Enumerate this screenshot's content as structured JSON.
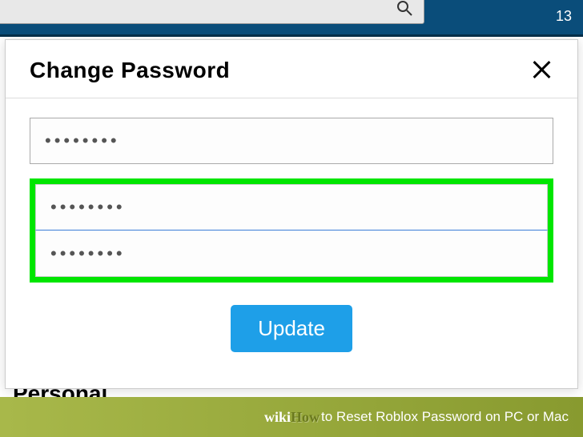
{
  "topbar": {
    "time_fragment": "13"
  },
  "modal": {
    "title": "Change Password",
    "current_password": "••••••••",
    "new_password": "••••••••",
    "confirm_password": "••••••••",
    "update_label": "Update"
  },
  "page": {
    "heading_fragment": "Personal"
  },
  "caption": {
    "brand_prefix": "wiki",
    "brand_suffix": "How",
    "text": " to Reset Roblox Password on PC or Mac"
  }
}
